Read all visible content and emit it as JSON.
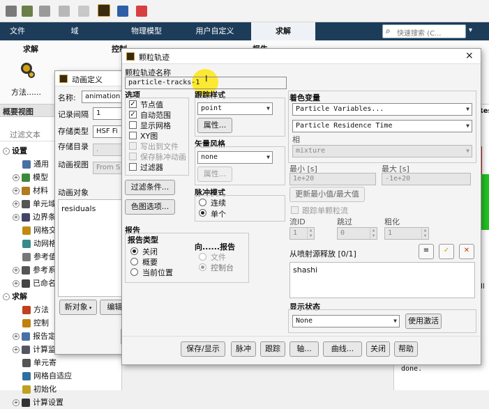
{
  "ribbon": {
    "tabs": [
      "文件",
      "域",
      "物理模型",
      "用户自定义",
      "求解"
    ],
    "search_placeholder": "快速搜索 (C..."
  },
  "ribbon_panel": {
    "left_label": "求解",
    "control_label": "控制",
    "report_label": "报告",
    "method_label": "方法......"
  },
  "outline": {
    "title": "概要视图",
    "filter_placeholder": "过滤文本",
    "items": [
      {
        "label": "设置",
        "level": 0,
        "expander": "-"
      },
      {
        "label": "通用",
        "level": 1
      },
      {
        "label": "模型",
        "level": 1,
        "expander": "+"
      },
      {
        "label": "材料",
        "level": 1,
        "expander": "+"
      },
      {
        "label": "单元域",
        "level": 1,
        "expander": "+"
      },
      {
        "label": "边界条",
        "level": 1,
        "expander": "+"
      },
      {
        "label": "网格交",
        "level": 1
      },
      {
        "label": "动网格",
        "level": 1
      },
      {
        "label": "参考值",
        "level": 1
      },
      {
        "label": "参考系",
        "level": 1,
        "expander": "+"
      },
      {
        "label": "已命名",
        "level": 1,
        "expander": "+"
      },
      {
        "label": "求解",
        "level": 0,
        "expander": "-"
      },
      {
        "label": "方法",
        "level": 1
      },
      {
        "label": "控制",
        "level": 1
      },
      {
        "label": "报告定",
        "level": 1,
        "expander": "+"
      },
      {
        "label": "计算监",
        "level": 1,
        "expander": "+"
      },
      {
        "label": "单元寄",
        "level": 1
      },
      {
        "label": "网格自适应",
        "level": 1
      },
      {
        "label": "初始化",
        "level": 1
      },
      {
        "label": "计算设置",
        "level": 1,
        "expander": "+"
      }
    ]
  },
  "animation_dialog": {
    "title": "动画定义",
    "name_label": "名称:",
    "name_value": "animation",
    "record_interval_label": "记录间隔",
    "record_interval_value": "1",
    "storage_type_label": "存储类型",
    "storage_type_value": "HSF Fi",
    "storage_dir_label": "存储目录",
    "storage_dir_value": ".",
    "anim_view_label": "动画视图",
    "anim_view_value": "From S",
    "anim_objects_label": "动画对象",
    "objects": [
      "residuals"
    ],
    "new_object_button": "新对象",
    "edit_button": "编辑对"
  },
  "pathline_dialog": {
    "title": "颗粒轨迹",
    "name_label": "颗粒轨迹名称",
    "name_value": "particle-tracks-1",
    "options_label": "选项",
    "options": [
      {
        "label": "节点值",
        "checked": true,
        "enabled": true
      },
      {
        "label": "自动范围",
        "checked": true,
        "enabled": true
      },
      {
        "label": "显示网格",
        "checked": false,
        "enabled": true
      },
      {
        "label": "XY图",
        "checked": false,
        "enabled": true
      },
      {
        "label": "写出到文件",
        "checked": false,
        "enabled": false
      },
      {
        "label": "保存脉冲动画",
        "checked": false,
        "enabled": false
      },
      {
        "label": "过滤器",
        "checked": false,
        "enabled": true
      }
    ],
    "filter_button": "过滤条件...",
    "colormap_button": "色图选项...",
    "track_style_label": "跟踪样式",
    "track_style_value": "point",
    "track_attr_button": "属性...",
    "vector_style_label": "矢量风格",
    "vector_style_value": "none",
    "vector_attr_button": "属性...",
    "pulse_mode_label": "脉冲模式",
    "pulse_modes": [
      {
        "label": "连续",
        "selected": false
      },
      {
        "label": "单个",
        "selected": true
      }
    ],
    "color_var_label": "着色变量",
    "color_var_value": "Particle Variables...",
    "color_var_sub": "Particle Residence Time",
    "phase_label": "相",
    "phase_value": "mixture",
    "min_label": "最小 [s]",
    "min_value": "1e+20",
    "max_label": "最大 [s]",
    "max_value": "-1e+20",
    "update_minmax_button": "更新最小值/最大值",
    "track_single_label": "跟踪单颗粒流",
    "stream_id_label": "流ID",
    "stream_id_value": "1",
    "skip_label": "跳过",
    "skip_value": "0",
    "coarsen_label": "粗化",
    "coarsen_value": "1",
    "release_label": "从喷射源释放 [0/1]",
    "release_items": [
      "shashi"
    ],
    "report_label": "报告",
    "report_type_label": "报告类型",
    "report_types": [
      {
        "label": "关闭",
        "selected": true
      },
      {
        "label": "概要",
        "selected": false
      },
      {
        "label": "当前位置",
        "selected": false
      }
    ],
    "report_to_label": "向......报告",
    "report_to": [
      {
        "label": "文件",
        "selected": false
      },
      {
        "label": "控制台",
        "selected": true
      }
    ],
    "display_state_label": "显示状态",
    "display_state_value": "None",
    "use_active_button": "使用激活",
    "footer_buttons": [
      "保存/显示",
      "脉冲",
      "跟踪",
      "轴...",
      "曲线...",
      "关闭",
      "帮助"
    ]
  },
  "background": {
    "console_text": "done.",
    "right_label_all": "all",
    "right_label_fe": "Res"
  },
  "colors": {
    "ribbon_bg": "#1c3c5a",
    "highlight": "#ffe600",
    "plot_green": "#22c122",
    "plot_red": "#cc2020"
  }
}
